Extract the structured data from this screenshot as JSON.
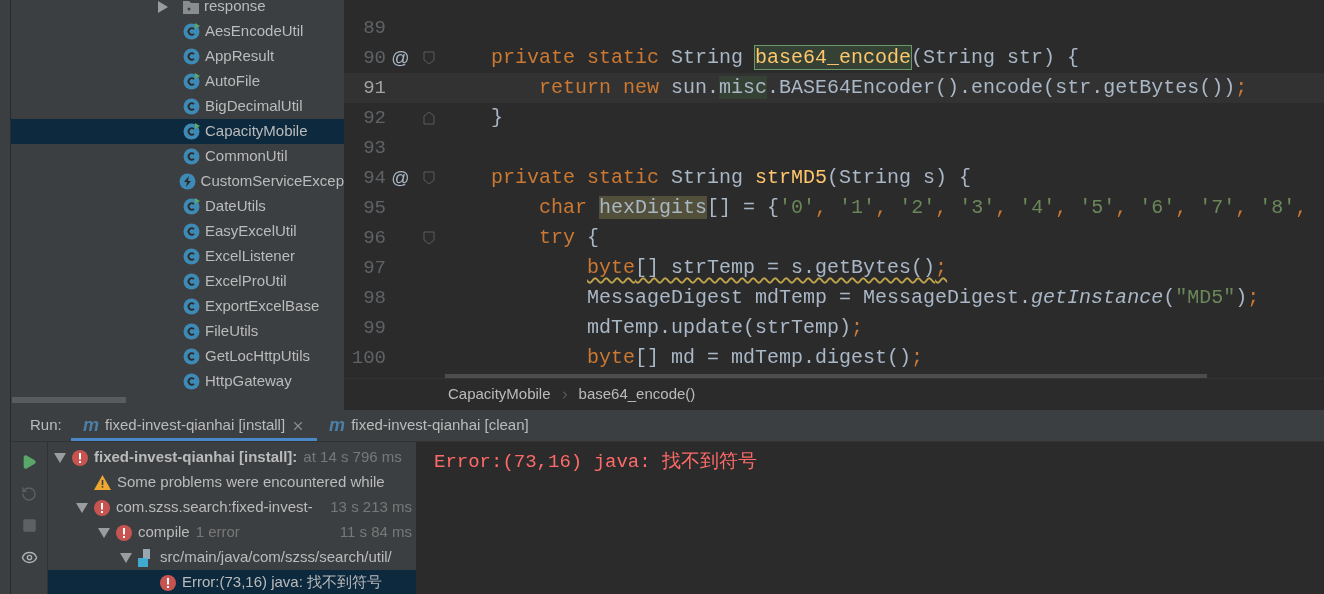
{
  "project_tree": {
    "items": [
      {
        "label": "response",
        "kind": "folder",
        "expanded": false,
        "selected": false
      },
      {
        "label": "AesEncodeUtil",
        "kind": "class-runnable",
        "selected": false
      },
      {
        "label": "AppResult",
        "kind": "class",
        "selected": false
      },
      {
        "label": "AutoFile",
        "kind": "class-runnable",
        "selected": false
      },
      {
        "label": "BigDecimalUtil",
        "kind": "class",
        "selected": false
      },
      {
        "label": "CapacityMobile",
        "kind": "class-runnable",
        "selected": true
      },
      {
        "label": "CommonUtil",
        "kind": "class",
        "selected": false
      },
      {
        "label": "CustomServiceExcep",
        "kind": "exception",
        "selected": false
      },
      {
        "label": "DateUtils",
        "kind": "class-runnable",
        "selected": false
      },
      {
        "label": "EasyExcelUtil",
        "kind": "class",
        "selected": false
      },
      {
        "label": "ExcelListener",
        "kind": "class",
        "selected": false
      },
      {
        "label": "ExcelProUtil",
        "kind": "class",
        "selected": false
      },
      {
        "label": "ExportExcelBase",
        "kind": "class",
        "selected": false
      },
      {
        "label": "FileUtils",
        "kind": "class",
        "selected": false
      },
      {
        "label": "GetLocHttpUtils",
        "kind": "class",
        "selected": false
      },
      {
        "label": "HttpGateway",
        "kind": "class",
        "selected": false
      }
    ]
  },
  "editor": {
    "lines": [
      {
        "number": "89",
        "current": false
      },
      {
        "number": "90",
        "current": false,
        "marker": "@",
        "fold_start": true,
        "tokens": [
          {
            "text": "    private static ",
            "kind": "keyword"
          },
          {
            "text": "String ",
            "kind": "plain"
          },
          {
            "text": "base64_encode",
            "kind": "method",
            "color": "#344134"
          },
          {
            "text": "(String str) {",
            "kind": "plain"
          }
        ]
      },
      {
        "number": "91",
        "current": true,
        "tokens": [
          {
            "text": "        return new ",
            "kind": "keyword"
          },
          {
            "text": "sun.",
            "kind": "plain"
          },
          {
            "text": "misc",
            "kind": "plain",
            "color": "#344134"
          },
          {
            "text": ".BASE64Encoder().encode(str.getBytes())",
            "kind": "plain"
          },
          {
            "text": ";",
            "kind": "keyword"
          }
        ]
      },
      {
        "number": "92",
        "current": false,
        "fold_end": true,
        "tokens": [
          {
            "text": "    }",
            "kind": "plain"
          }
        ]
      },
      {
        "number": "93",
        "current": false
      },
      {
        "number": "94",
        "current": false,
        "marker": "@",
        "fold_start": true,
        "tokens": [
          {
            "text": "    private static ",
            "kind": "keyword"
          },
          {
            "text": "String ",
            "kind": "plain"
          },
          {
            "text": "strMD5",
            "kind": "method"
          },
          {
            "text": "(String s) {",
            "kind": "plain"
          }
        ]
      },
      {
        "number": "95",
        "current": false,
        "tokens": [
          {
            "text": "        char ",
            "kind": "keyword"
          },
          {
            "text": "hexDigits",
            "kind": "plain",
            "color": "#52503a"
          },
          {
            "text": "[] = {",
            "kind": "plain"
          },
          {
            "text": "'0'",
            "kind": "string"
          },
          {
            "text": ", ",
            "kind": "keyword"
          },
          {
            "text": "'1'",
            "kind": "string"
          },
          {
            "text": ", ",
            "kind": "keyword"
          },
          {
            "text": "'2'",
            "kind": "string"
          },
          {
            "text": ", ",
            "kind": "keyword"
          },
          {
            "text": "'3'",
            "kind": "string"
          },
          {
            "text": ", ",
            "kind": "keyword"
          },
          {
            "text": "'4'",
            "kind": "string"
          },
          {
            "text": ", ",
            "kind": "keyword"
          },
          {
            "text": "'5'",
            "kind": "string"
          },
          {
            "text": ", ",
            "kind": "keyword"
          },
          {
            "text": "'6'",
            "kind": "string"
          },
          {
            "text": ", ",
            "kind": "keyword"
          },
          {
            "text": "'7'",
            "kind": "string"
          },
          {
            "text": ", ",
            "kind": "keyword"
          },
          {
            "text": "'8'",
            "kind": "string"
          },
          {
            "text": ",",
            "kind": "keyword"
          }
        ]
      },
      {
        "number": "96",
        "current": false,
        "fold_start": true,
        "tokens": [
          {
            "text": "        try ",
            "kind": "keyword"
          },
          {
            "text": "{",
            "kind": "plain"
          }
        ]
      },
      {
        "number": "97",
        "current": false,
        "tokens": [
          {
            "text": "            byte",
            "kind": "keyword",
            "squiggle": true
          },
          {
            "text": "[] strTemp = s.getBytes()",
            "kind": "plain",
            "squiggle": true
          },
          {
            "text": ";",
            "kind": "keyword",
            "squiggle": true
          }
        ]
      },
      {
        "number": "98",
        "current": false,
        "tokens": [
          {
            "text": "            MessageDigest mdTemp = MessageDigest.",
            "kind": "plain"
          },
          {
            "text": "getInstance",
            "kind": "italic"
          },
          {
            "text": "(",
            "kind": "plain"
          },
          {
            "text": "\"MD5\"",
            "kind": "string"
          },
          {
            "text": ")",
            "kind": "plain"
          },
          {
            "text": ";",
            "kind": "keyword"
          }
        ]
      },
      {
        "number": "99",
        "current": false,
        "tokens": [
          {
            "text": "            mdTemp.update(strTemp)",
            "kind": "plain"
          },
          {
            "text": ";",
            "kind": "keyword"
          }
        ]
      },
      {
        "number": "100",
        "current": false,
        "tokens": [
          {
            "text": "            byte",
            "kind": "keyword"
          },
          {
            "text": "[] md = mdTemp.digest()",
            "kind": "plain"
          },
          {
            "text": ";",
            "kind": "keyword"
          }
        ]
      }
    ],
    "breadcrumbs": [
      "CapacityMobile",
      "base64_encode()"
    ]
  },
  "run": {
    "label": "Run:",
    "tabs": [
      {
        "badge": "m",
        "label": "fixed-invest-qianhai [install]",
        "selected": true,
        "closable": true
      },
      {
        "badge": "m",
        "label": "fixed-invest-qianhai [clean]",
        "selected": false
      }
    ],
    "tree": [
      {
        "kind": "error",
        "label": "fixed-invest-qianhai [install]:",
        "bold": true,
        "detail": "at 14 s 796 ms",
        "expanded": true,
        "selected": false,
        "children": [
          {
            "kind": "warning",
            "label": "Some problems were encountered while",
            "selected": false
          },
          {
            "kind": "error",
            "label": "com.szss.search:fixed-invest-",
            "time": "13 s 213 ms",
            "expanded": true,
            "selected": false,
            "children": [
              {
                "kind": "error",
                "label": "compile",
                "detail": "1 error",
                "time": "11 s 84 ms",
                "expanded": true,
                "selected": false,
                "children": [
                  {
                    "kind": "file",
                    "label": "src/main/java/com/szss/search/util/",
                    "expanded": true,
                    "selected": false,
                    "children": [
                      {
                        "kind": "error",
                        "label": "Error:(73,16) java: 找不到符号",
                        "selected": true
                      }
                    ]
                  }
                ]
              }
            ]
          }
        ]
      }
    ],
    "console": [
      "Error:(73,16) java: 找不到符号"
    ]
  }
}
